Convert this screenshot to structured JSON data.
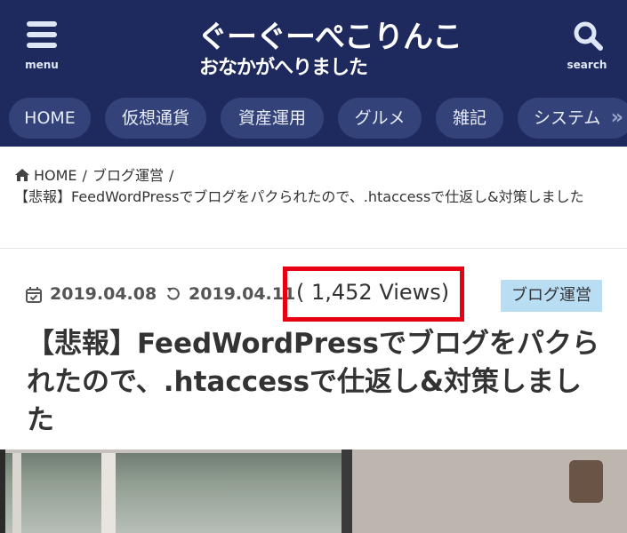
{
  "header": {
    "menu_label": "menu",
    "search_label": "search",
    "logo_line1": "ぐーぐーぺこりんこ",
    "logo_line2": "おなかがへりました"
  },
  "nav": {
    "items": [
      {
        "label": "HOME"
      },
      {
        "label": "仮想通貨"
      },
      {
        "label": "資産運用"
      },
      {
        "label": "グルメ"
      },
      {
        "label": "雑記"
      },
      {
        "label": "システム"
      }
    ],
    "more_glyph": "»"
  },
  "breadcrumb": {
    "home": "HOME",
    "category": "ブログ運営",
    "separator": "/",
    "current": "【悲報】FeedWordPressでブログをパクられたので、.htaccessで仕返し&対策しました"
  },
  "article": {
    "published": "2019.04.08",
    "updated": "2019.04.11",
    "views": "( 1,452 Views)",
    "category_tag": "ブログ運営",
    "title": "【悲報】FeedWordPressでブログをパクられたので、.htaccessで仕返し&対策しました"
  },
  "colors": {
    "header_bg": "#1e2a5e",
    "pill_bg": "#34427a",
    "highlight_border": "#e60012",
    "tag_bg": "#b9ddf3"
  },
  "icons": {
    "menu": "hamburger-icon",
    "search": "search-icon",
    "home": "home-icon",
    "calendar": "calendar-check-icon",
    "updated": "refresh-icon"
  }
}
